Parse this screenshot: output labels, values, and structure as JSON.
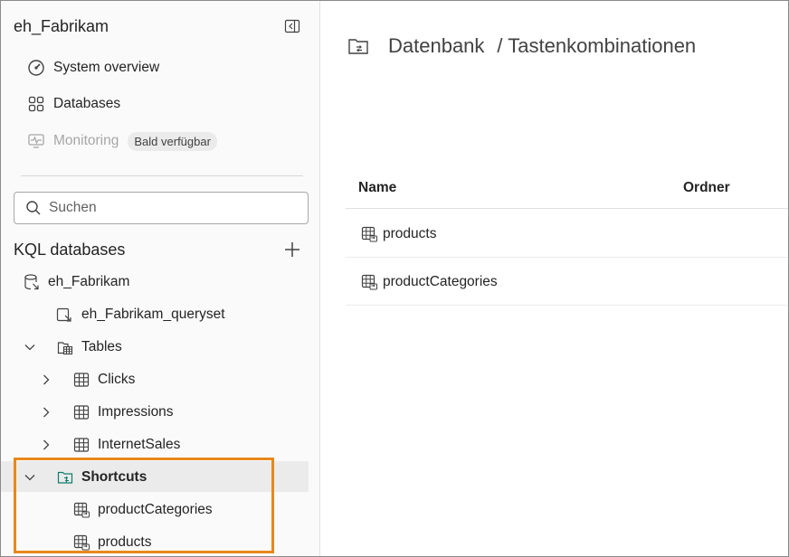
{
  "sidebar": {
    "workspace_title": "eh_Fabrikam",
    "nav": [
      {
        "label": "System overview",
        "icon": "gauge-icon"
      },
      {
        "label": "Databases",
        "icon": "grid-icon"
      },
      {
        "label": "Monitoring",
        "icon": "monitor-icon",
        "badge": "Bald verfügbar",
        "disabled": true
      }
    ],
    "search": {
      "placeholder": "Suchen"
    },
    "section_title": "KQL databases",
    "tree": {
      "database": "eh_Fabrikam",
      "queryset": "eh_Fabrikam_queryset",
      "tables_label": "Tables",
      "tables": [
        "Clicks",
        "Impressions",
        "InternetSales"
      ],
      "shortcuts_label": "Shortcuts",
      "shortcuts": [
        "productCategories",
        "products"
      ]
    }
  },
  "main": {
    "breadcrumb": {
      "part1": "Datenbank",
      "part2": "/ Tastenkombinationen"
    },
    "table": {
      "columns": [
        "Name",
        "Ordner"
      ],
      "rows": [
        {
          "name": "products"
        },
        {
          "name": "productCategories"
        }
      ]
    }
  },
  "colors": {
    "highlight": "#e8881b",
    "accent": "#0f7b6c"
  }
}
